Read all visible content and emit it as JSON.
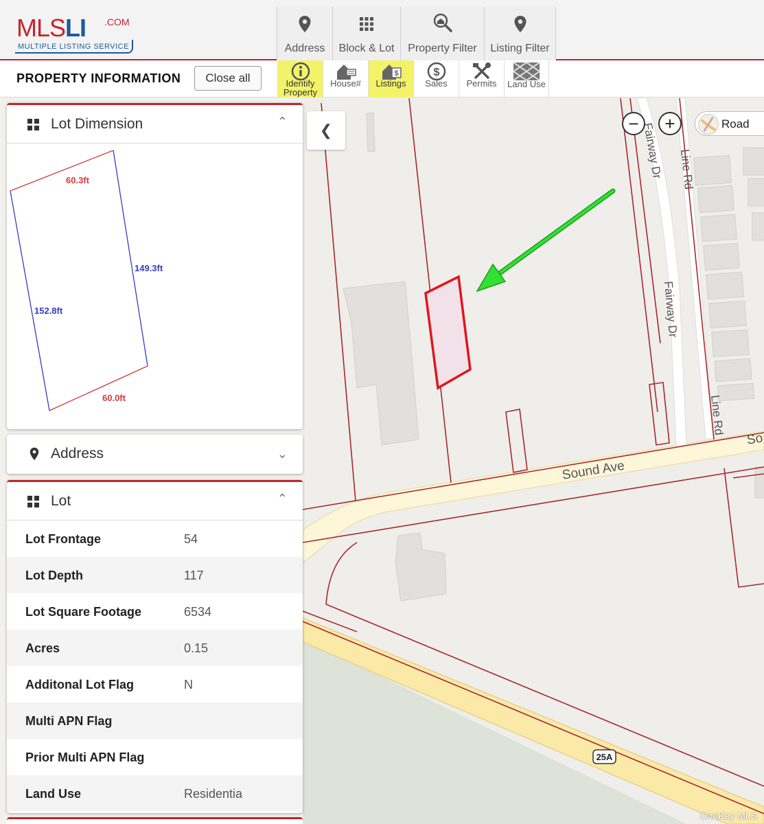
{
  "logo": {
    "brand_mls": "MLS",
    "brand_li": "LI",
    "dotcom": ".COM",
    "tagline": "MULTIPLE LISTING SERVICE"
  },
  "top_tabs": [
    {
      "label": "Address",
      "icon": "map-pin-icon"
    },
    {
      "label": "Block & Lot",
      "icon": "grid-icon"
    },
    {
      "label": "Property Filter",
      "icon": "search-house-icon"
    },
    {
      "label": "Listing Filter",
      "icon": "map-pin-icon"
    }
  ],
  "subbar": {
    "title": "PROPERTY INFORMATION",
    "close_all": "Close all",
    "tools": [
      {
        "label": "Identify Property",
        "icon": "info-icon",
        "active": true
      },
      {
        "label": "House#",
        "icon": "house-number-icon",
        "active": false
      },
      {
        "label": "Listings",
        "icon": "house-dollar-icon",
        "active": true
      },
      {
        "label": "Sales",
        "icon": "dollar-circle-icon",
        "active": false
      },
      {
        "label": "Permits",
        "icon": "tools-icon",
        "active": false
      },
      {
        "label": "Land Use",
        "icon": "land-use-icon",
        "active": false
      }
    ]
  },
  "lot_dimension": {
    "title": "Lot Dimension",
    "top": "60.3ft",
    "right": "149.3ft",
    "left": "152.8ft",
    "bottom": "60.0ft"
  },
  "address_panel": {
    "title": "Address"
  },
  "lot_panel": {
    "title": "Lot",
    "rows": [
      {
        "key": "Lot Frontage",
        "value": "54"
      },
      {
        "key": "Lot Depth",
        "value": "117"
      },
      {
        "key": "Lot Square Footage",
        "value": "6534"
      },
      {
        "key": "Acres",
        "value": "0.15"
      },
      {
        "key": "Additonal Lot Flag",
        "value": "N"
      },
      {
        "key": "Multi APN Flag",
        "value": ""
      },
      {
        "key": "Prior Multi APN Flag",
        "value": ""
      },
      {
        "key": "Land Use",
        "value": "Residentia"
      }
    ]
  },
  "map": {
    "road_toggle": "Road",
    "labels": {
      "fairway_dr_1": "Fairway Dr",
      "fairway_dr_2": "Fairway Dr",
      "line_rd_1": "Line Rd",
      "line_rd_2": "Line Rd",
      "sound_ave": "Sound Ave",
      "sound_ave_cut": "So",
      "route": "25A"
    },
    "highlight_color": "#e0161c",
    "arrow_color": "#22dd22"
  },
  "watermark": "OneKey MLS"
}
